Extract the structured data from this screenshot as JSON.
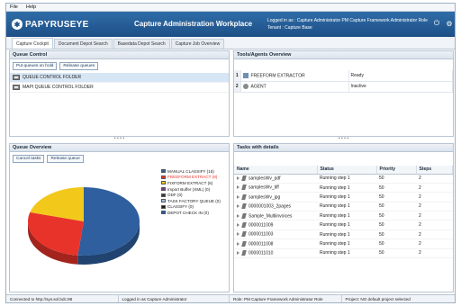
{
  "menu": [
    "File",
    "Help"
  ],
  "header": {
    "logo_text": "PAPYRUSEYE",
    "title": "Capture Administration Workplace",
    "user_line": "Logged in as : Capture Administrator   PM Capture Framework Administrator Role",
    "tenant_line": "Tenant : Capture Base"
  },
  "tabs": [
    "Capture Cockpit",
    "Document Depot Search",
    "Basedata Depot Search",
    "Capture Job Overview"
  ],
  "queue_control": {
    "title": "Queue Control",
    "buttons": [
      "Put queues on hold",
      "Release queues"
    ],
    "items": [
      "QUEUE CONTROL FOLDER",
      "MAPI QUEUE CONTROL FOLDER"
    ]
  },
  "tools_agents": {
    "title": "Tools/Agents Overview",
    "rows": [
      {
        "num": "1",
        "name": "FREEFORM EXTRACTOR",
        "status": "Ready"
      },
      {
        "num": "2",
        "name": "AGENT",
        "status": "Inactive"
      }
    ]
  },
  "queue_overview": {
    "title": "Queue Overview",
    "buttons": [
      "Cancel tasks",
      "Release queue"
    ]
  },
  "chart_data": {
    "type": "pie",
    "categories": [
      "MANUAL CLASSIFY (15)",
      "FREEFORM EXTRACT (8)",
      "FIXFORM EXTRACT (6)",
      "Import Buffer (XML) (0)",
      "ODF (0)",
      "TASK FACTORY QUEUE (0)",
      "CLASSIFY (0)",
      "DEPOT CHECK IN (0)"
    ],
    "values": [
      15,
      8,
      6,
      0,
      0,
      0,
      0,
      0
    ],
    "colors": [
      "#2f5f9e",
      "#e8332a",
      "#f2c81b",
      "#7a3b8c",
      "#3a3a3a",
      "#9ec3e6",
      "#1a1a1a",
      "#1e5aa8"
    ]
  },
  "tasks": {
    "title": "Tasks with details",
    "columns": [
      "Name",
      "Status",
      "Priority",
      "Steps"
    ],
    "rows": [
      {
        "name": "samplesWv_pdf",
        "status": "Running step 1",
        "priority": "50",
        "steps": "2"
      },
      {
        "name": "samplesWv_tiff",
        "status": "Running step 1",
        "priority": "50",
        "steps": "2"
      },
      {
        "name": "samplesWv_jpg",
        "status": "Running step 1",
        "priority": "50",
        "steps": "2"
      },
      {
        "name": "0000001003_2pages",
        "status": "Running step 1",
        "priority": "50",
        "steps": "2"
      },
      {
        "name": "Sample_Multiinvoices",
        "status": "Running step 1",
        "priority": "50",
        "steps": "2"
      },
      {
        "name": "0000011009",
        "status": "Running step 1",
        "priority": "50",
        "steps": "2"
      },
      {
        "name": "0000011003",
        "status": "Running step 1",
        "priority": "50",
        "steps": "2"
      },
      {
        "name": "0000011008",
        "status": "Running step 1",
        "priority": "50",
        "steps": "2"
      },
      {
        "name": "0000011010",
        "status": "Running step 1",
        "priority": "50",
        "steps": "2"
      }
    ]
  },
  "status": {
    "connected": "Connected to http://sys.sol.bdc:88",
    "logged": "Logged in as Capture Administrator",
    "role": "Role: PM Capture Framework Administrator Role",
    "project": "Project: NO default project selected"
  }
}
